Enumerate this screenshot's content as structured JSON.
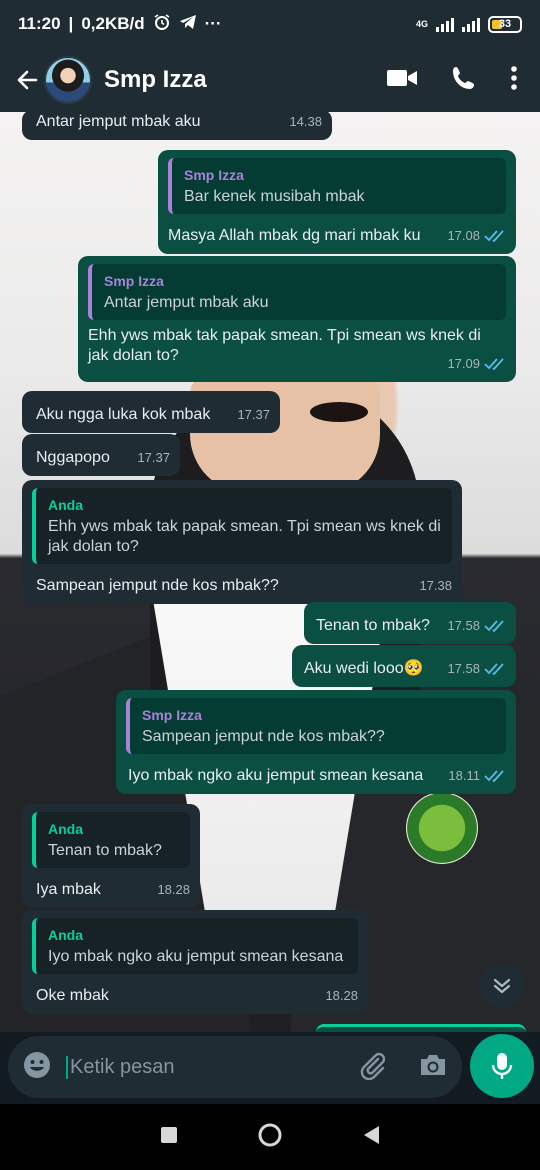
{
  "status": {
    "time": "11:20",
    "speed": "0,2KB/d",
    "more": "···",
    "network": "4G",
    "battery": "33"
  },
  "header": {
    "contact": "Smp Izza"
  },
  "messages": [
    {
      "dir": "in",
      "text": "Antar jemput mbak aku",
      "time": "14.38"
    },
    {
      "dir": "out",
      "quote_name": "Smp Izza",
      "quote_text": "Bar kenek musibah mbak",
      "text": "Masya Allah mbak dg mari mbak ku",
      "time": "17.08"
    },
    {
      "dir": "out",
      "quote_name": "Smp Izza",
      "quote_text": "Antar jemput mbak aku",
      "text": "Ehh yws mbak tak papak smean. Tpi smean ws knek di jak dolan to?",
      "time": "17.09"
    },
    {
      "dir": "in",
      "text": "Aku ngga luka kok mbak",
      "time": "17.37"
    },
    {
      "dir": "in",
      "text": "Nggapopo",
      "time": "17.37"
    },
    {
      "dir": "in",
      "quote_name": "Anda",
      "quote_text": "Ehh yws mbak tak papak smean. Tpi smean ws knek di jak dolan to?",
      "text": "Sampean jemput nde kos mbak??",
      "time": "17.38"
    },
    {
      "dir": "out",
      "text": "Tenan to mbak?",
      "time": "17.58"
    },
    {
      "dir": "out",
      "text": "Aku wedi looo",
      "emoji": "🥺",
      "time": "17.58"
    },
    {
      "dir": "out",
      "quote_name": "Smp Izza",
      "quote_text": "Sampean jemput nde kos mbak??",
      "text": "Iyo mbak ngko aku jemput smean kesana",
      "time": "18.11"
    },
    {
      "dir": "in",
      "quote_name": "Anda",
      "quote_text": "Tenan to mbak?",
      "text": "Iya mbak",
      "time": "18.28"
    },
    {
      "dir": "in",
      "quote_name": "Anda",
      "quote_text": "Iyo mbak ngko aku jemput smean kesana",
      "text": "Oke mbak",
      "time": "18.28"
    }
  ],
  "input": {
    "placeholder": "Ketik pesan"
  },
  "colors": {
    "accent": "#00a884",
    "outgoing": "#0b4f43",
    "incoming": "#1f2c34",
    "read_tick": "#53bdeb"
  }
}
